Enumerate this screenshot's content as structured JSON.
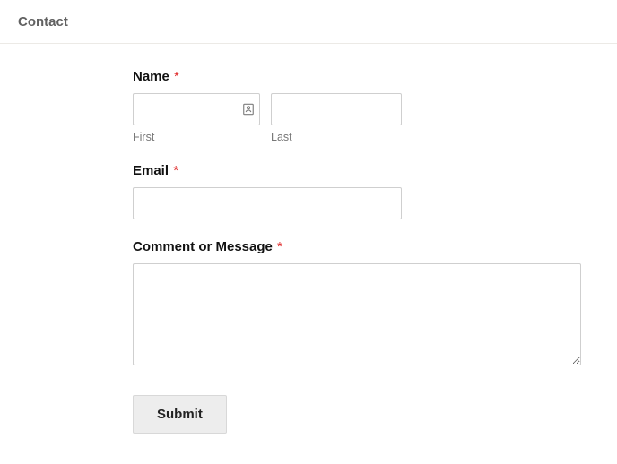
{
  "header": {
    "title": "Contact"
  },
  "form": {
    "name": {
      "label": "Name",
      "required_mark": "*",
      "first": {
        "value": "",
        "sublabel": "First"
      },
      "last": {
        "value": "",
        "sublabel": "Last"
      }
    },
    "email": {
      "label": "Email",
      "required_mark": "*",
      "value": ""
    },
    "message": {
      "label": "Comment or Message",
      "required_mark": "*",
      "value": ""
    },
    "submit": {
      "label": "Submit"
    }
  }
}
